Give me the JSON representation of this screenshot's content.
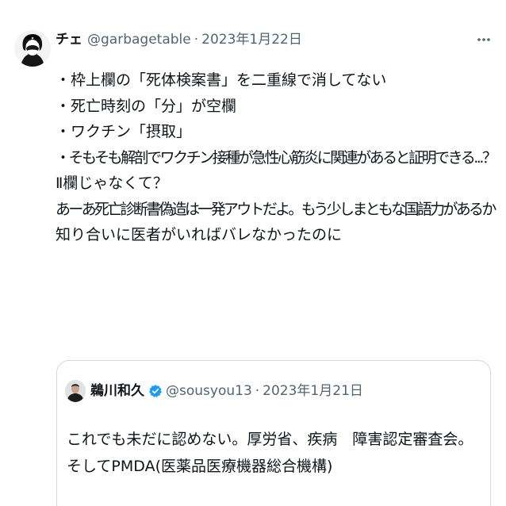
{
  "tweet": {
    "author": {
      "display_name": "チェ",
      "handle": "@garbagetable",
      "separator": "·",
      "date": "2023年1月22日",
      "avatar_icon": "portrait-icon"
    },
    "more_icon": "more-dots-icon",
    "lines": [
      "・枠上欄の「死体検案書」を二重線で消してない",
      "・死亡時刻の「分」が空欄",
      "・ワクチン「摂取」",
      "・そもそも解剖でワクチン接種が急性心筋炎に関連があると証明できる...？",
      "Ⅱ欄じゃなくて？",
      "あーあ死亡診断書偽造は一発アウトだよ。もう少しまともな国語力があるか",
      "知り合いに医者がいればバレなかったのに"
    ]
  },
  "quoted_tweet": {
    "author": {
      "display_name": "鵜川和久",
      "verified_icon": "verified-badge-icon",
      "handle": "@sousyou13",
      "separator": "·",
      "date": "2023年1月21日",
      "avatar_icon": "portrait-icon"
    },
    "lines": [
      "これでも未だに認めない。厚労省、疾病　障害認定審査会。",
      "そしてPMDA(医薬品医療機器総合機構)"
    ]
  },
  "colors": {
    "text_primary": "#0f1419",
    "text_secondary": "#536471",
    "border": "#cfd9de",
    "verified_blue": "#1d9bf0"
  }
}
